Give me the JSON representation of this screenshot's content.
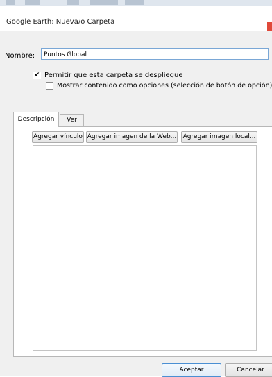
{
  "window": {
    "title": "Google Earth: Nueva/o Carpeta",
    "accent_color": "#e0493a"
  },
  "form": {
    "name_label": "Nombre:",
    "name_value": "Puntos Global"
  },
  "options": {
    "allow_expand_label": "Permitir que esta carpeta se despliegue",
    "allow_expand_checked": true,
    "show_as_radio_label": "Mostrar contenido como opciones (selección de botón de opción)",
    "show_as_radio_checked": false,
    "check_glyph": "✔"
  },
  "tabs": [
    {
      "label": "Descripción",
      "active": true
    },
    {
      "label": "Ver",
      "active": false
    }
  ],
  "description_toolbar": {
    "add_link": "Agregar vínculo",
    "add_web_image": "Agregar imagen de la Web...",
    "add_local_image": "Agregar imagen local..."
  },
  "description_text": "",
  "footer": {
    "ok": "Aceptar",
    "cancel": "Cancelar"
  }
}
